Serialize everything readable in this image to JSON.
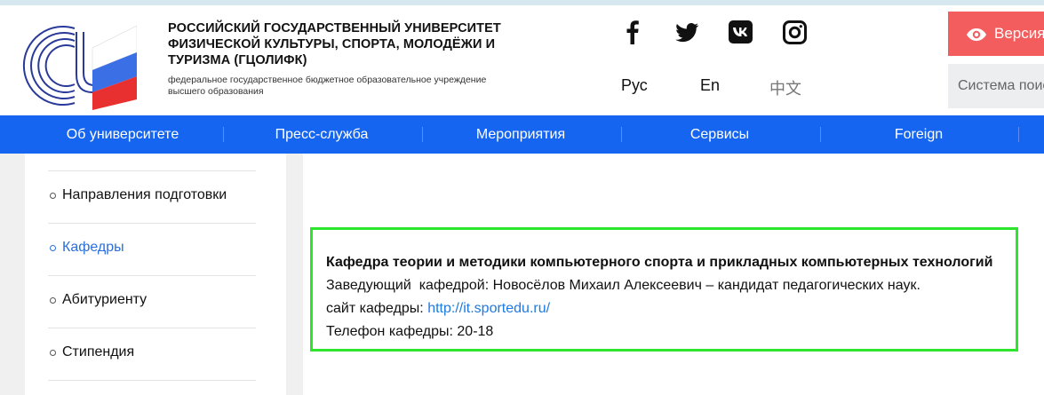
{
  "header": {
    "title": "РОССИЙСКИЙ ГОСУДАРСТВЕННЫЙ УНИВЕРСИТЕТ ФИЗИЧЕСКОЙ КУЛЬТУРЫ, СПОРТА, МОЛОДЁЖИ И ТУРИЗМА (ГЦОЛИФК)",
    "subtitle": "федеральное государственное бюджетное образовательное учреждение высшего образования",
    "social": [
      "facebook-icon",
      "twitter-icon",
      "vk-icon",
      "instagram-icon"
    ],
    "languages": [
      "Рус",
      "En",
      "中文"
    ],
    "version_button": "Версия для слабовидящих",
    "search_placeholder": "Система поиска"
  },
  "nav": {
    "items": [
      "Об университете",
      "Пресс-служба",
      "Мероприятия",
      "Сервисы",
      "Foreign"
    ]
  },
  "sidebar": {
    "items": [
      {
        "label": "Направления подготовки",
        "active": false
      },
      {
        "label": "Кафедры",
        "active": true
      },
      {
        "label": "Абитуриенту",
        "active": false
      },
      {
        "label": "Стипендия",
        "active": false
      }
    ]
  },
  "card": {
    "title": "Кафедра теории и методики компьютерного спорта и прикладных компьютерных технологий",
    "head_line": "Заведующий  кафедрой: Новосёлов Михаил Алексеевич – кандидат педагогических наук.",
    "site_label": "сайт кафедры: ",
    "site_link": "http://it.sportedu.ru/",
    "phone": "Телефон кафедры: 20-18"
  },
  "colors": {
    "nav_bg": "#1565f0",
    "version_btn": "#f45d5d",
    "link": "#1f7ae0",
    "card_border": "#2ee52e"
  }
}
